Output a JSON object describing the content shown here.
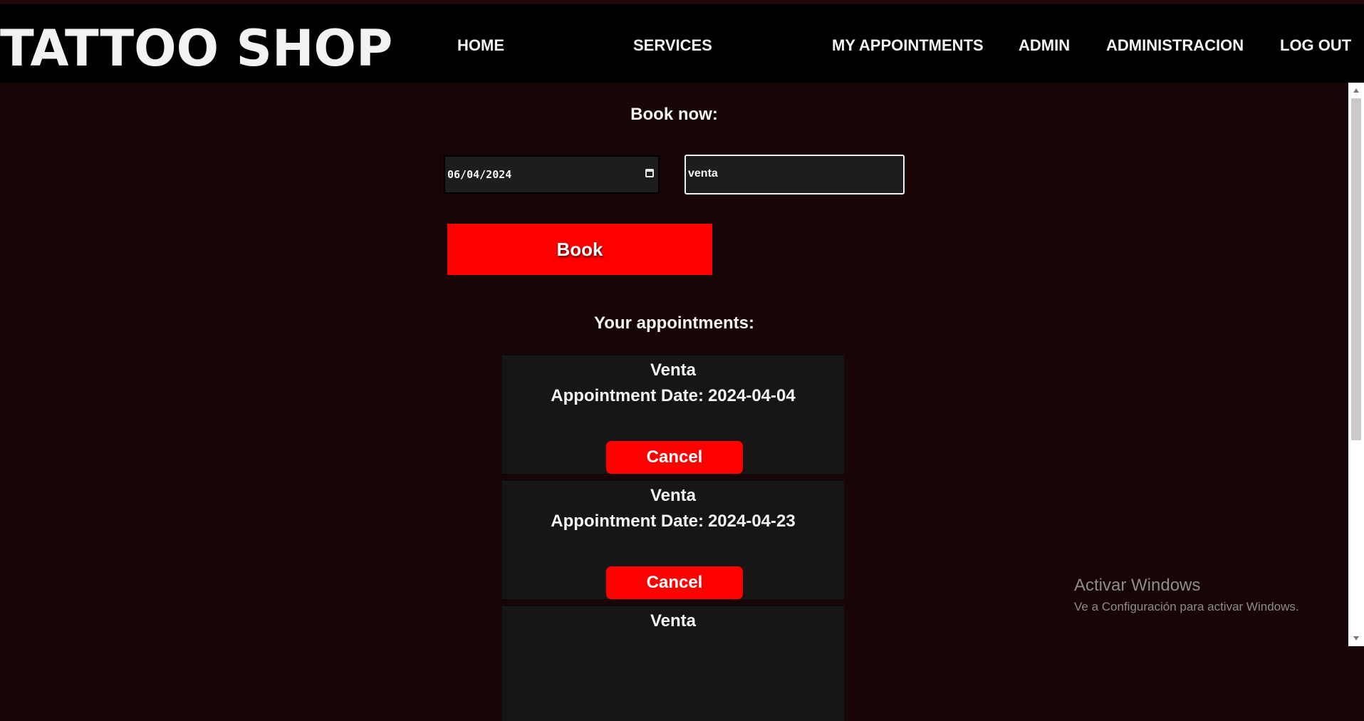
{
  "app": {
    "logo": "TATTOO SHOP"
  },
  "nav": {
    "home": "HOME",
    "services": "SERVICES",
    "my_appointments": "MY APPOINTMENTS",
    "admin": "ADMIN",
    "administracion": "ADMINISTRACION",
    "logout": "LOG OUT"
  },
  "booking": {
    "heading": "Book now:",
    "date_value": "06/04/2024",
    "service_value": "venta",
    "book_label": "Book"
  },
  "appointments": {
    "heading": "Your appointments:",
    "date_label": "Appointment Date:",
    "cancel_label": "Cancel",
    "items": [
      {
        "service": "Venta",
        "date": "2024-04-04"
      },
      {
        "service": "Venta",
        "date": "2024-04-23"
      },
      {
        "service": "Venta",
        "date": ""
      }
    ]
  },
  "watermark": {
    "title": "Activar Windows",
    "subtitle": "Ve a Configuración para activar Windows."
  },
  "colors": {
    "accent": "#ff0000",
    "background": "#180505",
    "navbar": "#000000",
    "card": "#161616"
  }
}
